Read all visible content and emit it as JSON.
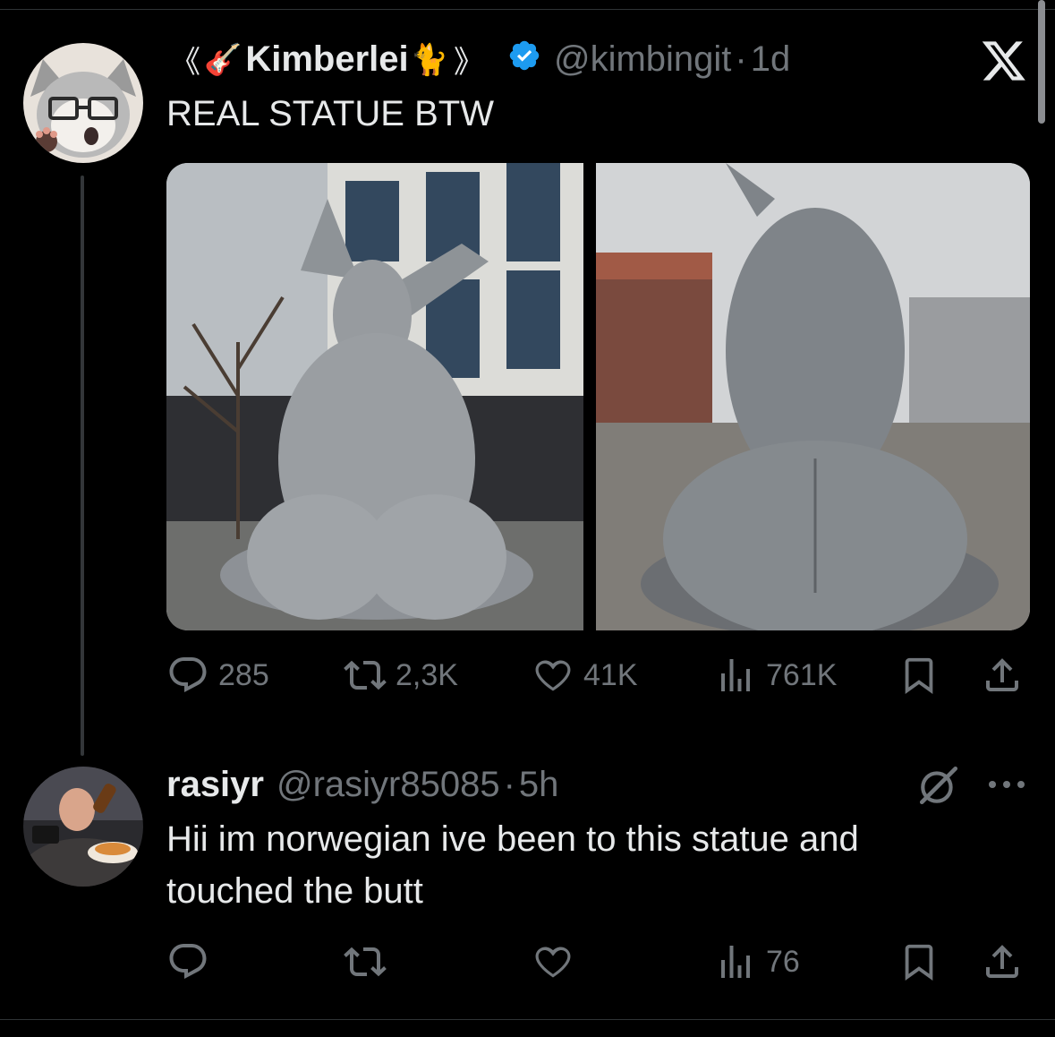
{
  "post": {
    "name_prefix": "《",
    "name_guitar": "🎸",
    "display_name": "Kimberlei",
    "name_cat": "🐈",
    "name_suffix": "》",
    "verified": true,
    "handle": "@kimbingit",
    "separator": "·",
    "time": "1d",
    "text": "REAL STATUE BTW",
    "media_count": 2,
    "stats": {
      "replies": "285",
      "reposts": "2,3K",
      "likes": "41K",
      "views": "761K"
    }
  },
  "reply": {
    "display_name": "rasiyr",
    "handle": "@rasiyr85085",
    "separator": "·",
    "time": "5h",
    "text_line1": "Hii im norwegian ive been to this statue and",
    "text_line2": "touched the butt",
    "stats": {
      "views": "76"
    }
  },
  "icons": {
    "brand": "x-logo-icon",
    "verified": "verified-badge-icon",
    "reply": "reply-icon",
    "repost": "repost-icon",
    "like": "like-icon",
    "views": "views-icon",
    "bookmark": "bookmark-icon",
    "share": "share-icon",
    "grok": "grok-icon",
    "more": "more-icon"
  },
  "colors": {
    "background": "#000000",
    "text": "#e7e9ea",
    "muted": "#71767b",
    "verified": "#1d9bf0",
    "divider": "#2f3336"
  }
}
